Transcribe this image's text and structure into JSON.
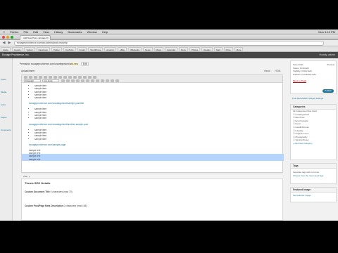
{
  "menubar": {
    "app": "Firefox",
    "items": [
      "File",
      "Edit",
      "View",
      "History",
      "Bookmarks",
      "Window",
      "Help"
    ],
    "clock": "Mon 4:13 PM"
  },
  "browser": {
    "tab_title": "Add New Post ‹ Ecoage Pr...",
    "url": "ecoageprovidence.com/wp-admin/post-new.php"
  },
  "bookmarks": [
    "Apple",
    "Google",
    "Yahoo!",
    "Facebook",
    "Twitter",
    "YouTube",
    "Gmail",
    "WordPress",
    "Amazon",
    "eBay",
    "Wikipedia",
    "News",
    "Maps",
    "Calendar",
    "Docs",
    "Photos",
    "Reader",
    "Mail",
    "Drive",
    "More"
  ],
  "admin": {
    "site": "Ecoage Providence, Inc.",
    "howdy": "Howdy, admin"
  },
  "leftmenu": [
    "Posts",
    "Media",
    "Links",
    "Pages",
    "Comments"
  ],
  "permalink": {
    "label": "Permalink:",
    "url": "ecoageprovidence.com/uncategorized/",
    "slug": "add-new",
    "edit": "Edit"
  },
  "editor": {
    "upload_label": "Upload/Insert",
    "tabs": [
      "Visual",
      "HTML"
    ],
    "format_select": "Paragraph",
    "font_select": "Font family",
    "content": {
      "group1": [
        "sample item",
        "sample item",
        "sample item",
        "sample item",
        "sample item"
      ],
      "link1": "ecoageprovidence.com/uncategorized/sample-post-title",
      "group2": [
        "sample item",
        "sample item",
        "sample item",
        "sample item"
      ],
      "link2": "ecoageprovidence.com/uncategorized/another-sample-post",
      "group3": [
        "sample item",
        "sample item",
        "sample item",
        "sample item"
      ],
      "link3": "ecoageprovidence.com/sample-page",
      "plain": [
        "sample text",
        "sample text",
        "sample text",
        "sample text"
      ]
    },
    "path": "Path: p",
    "word_count": "Word count: 0",
    "draft_status": "Draft saved at 4:13:02 pm."
  },
  "seo": {
    "title": "Thesis SEO Details",
    "field1_label": "Custom Document Title",
    "field1_hint": "0 characters (max 70)",
    "field2_label": "Custom Post/Page Meta Description",
    "field2_hint": "0 characters (max 165)"
  },
  "sidebar": {
    "publish": {
      "save_draft": "Save Draft",
      "preview": "Preview",
      "status": "Status: Draft Edit",
      "visibility": "Visibility: Public Edit",
      "schedule": "Publish immediately Edit",
      "trash": "Move to Trash",
      "update": "Publish"
    },
    "settings_title": "Post Meta Editor Widget Settings",
    "categories": {
      "title": "Categories",
      "tabs": "All Categories   Most Used",
      "items": [
        "Uncategorized",
        "Best Free",
        "Eco Products",
        "Food",
        "Health/Fitness",
        "Lifestyle",
        "Organic Food",
        "Photography",
        "Saving Money"
      ],
      "add": "+ Add New Category"
    },
    "tags": {
      "title": "Tags",
      "hint": "Separate tags with commas",
      "choose": "Choose from the most used tags"
    },
    "featured": {
      "title": "Featured Image",
      "link": "Set featured image"
    }
  },
  "colors": {
    "admin_bar": "#464646",
    "link": "#21759b",
    "highlight": "#b5d5ff",
    "button": "#21759b"
  }
}
